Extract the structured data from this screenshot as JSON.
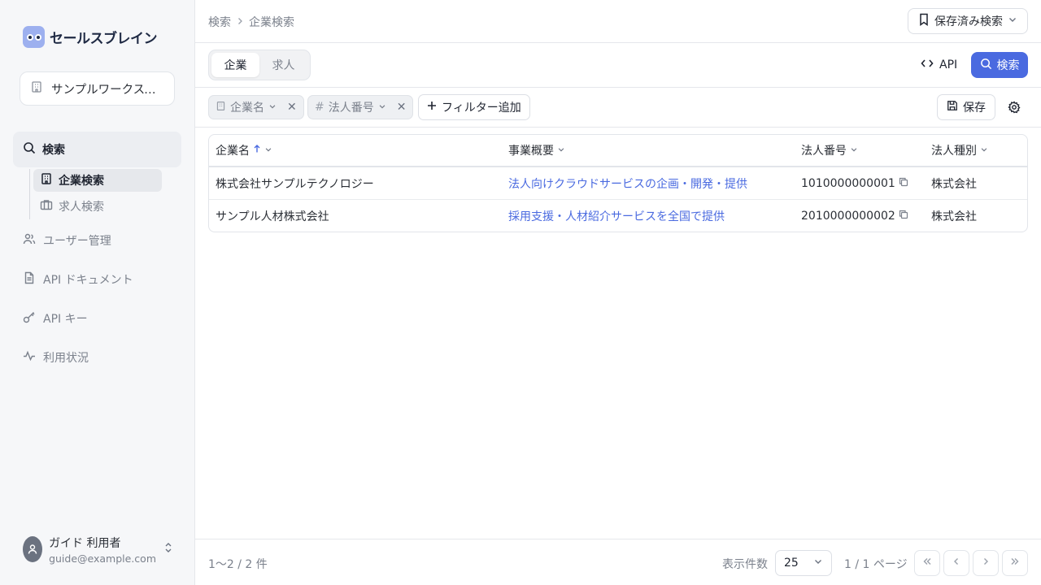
{
  "brand": {
    "name": "セールスブレイン"
  },
  "workspace": {
    "label": "サンプルワークスペ..."
  },
  "sidebar": {
    "search_label": "検索",
    "sub_items": [
      {
        "label": "企業検索",
        "icon": "building-icon"
      },
      {
        "label": "求人検索",
        "icon": "briefcase-icon"
      }
    ],
    "items": [
      {
        "label": "ユーザー管理",
        "icon": "users-icon"
      },
      {
        "label": "API ドキュメント",
        "icon": "document-icon"
      },
      {
        "label": "API キー",
        "icon": "key-icon"
      },
      {
        "label": "利用状況",
        "icon": "activity-icon"
      }
    ]
  },
  "user": {
    "name": "ガイド 利用者",
    "email": "guide@example.com"
  },
  "breadcrumb": {
    "root": "検索",
    "current": "企業検索"
  },
  "header": {
    "saved_searches_label": "保存済み検索"
  },
  "tabs": [
    {
      "label": "企業"
    },
    {
      "label": "求人"
    }
  ],
  "toolbar": {
    "api_label": "API",
    "search_label": "検索"
  },
  "filters": {
    "chips": [
      {
        "label": "企業名",
        "icon": "building-icon"
      },
      {
        "label": "法人番号",
        "icon": "hash-icon"
      }
    ],
    "add_label": "フィルター追加",
    "save_label": "保存"
  },
  "table": {
    "columns": [
      "企業名",
      "事業概要",
      "法人番号",
      "法人種別"
    ],
    "rows": [
      [
        "株式会社サンプルテクノロジー",
        "法人向けクラウドサービスの企画・開発・提供",
        "1010000000001",
        "株式会社"
      ],
      [
        "サンプル人材株式会社",
        "採用支援・人材紹介サービスを全国で提供",
        "2010000000002",
        "株式会社"
      ]
    ]
  },
  "footer": {
    "count": "1〜2 / 2 件",
    "per_page_label": "表示件数",
    "per_page_value": "25",
    "page_info": "1 / 1 ページ"
  },
  "colors": {
    "accent": "#4a6ae0",
    "sidebar_bg": "#f6f7f9",
    "logo": "#9db0ef"
  }
}
